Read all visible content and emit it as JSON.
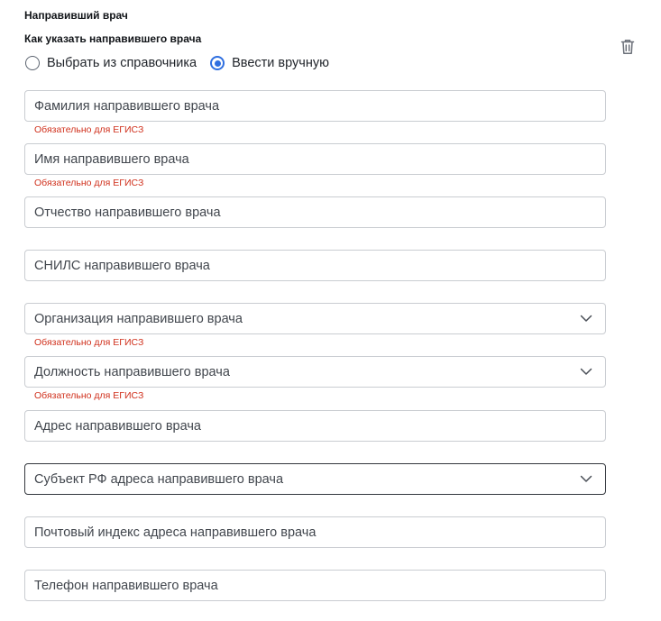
{
  "section": {
    "title": "Направивший врач",
    "mode_label": "Как указать направившего врача",
    "delete_icon": "trash-icon"
  },
  "mode": {
    "options": [
      {
        "label": "Выбрать из справочника",
        "selected": false
      },
      {
        "label": "Ввести вручную",
        "selected": true
      }
    ]
  },
  "fields": [
    {
      "placeholder": "Фамилия направившего врача",
      "type": "text",
      "hint": "Обязательно для ЕГИСЗ"
    },
    {
      "placeholder": "Имя направившего врача",
      "type": "text",
      "hint": "Обязательно для ЕГИСЗ"
    },
    {
      "placeholder": "Отчество направившего врача",
      "type": "text",
      "hint": ""
    },
    {
      "placeholder": "СНИЛС направившего врача",
      "type": "text",
      "hint": ""
    },
    {
      "placeholder": "Организация направившего врача",
      "type": "select",
      "hint": "Обязательно для ЕГИСЗ"
    },
    {
      "placeholder": "Должность направившего врача",
      "type": "select",
      "hint": "Обязательно для ЕГИСЗ"
    },
    {
      "placeholder": "Адрес направившего врача",
      "type": "text",
      "hint": ""
    },
    {
      "placeholder": "Субъект РФ адреса направившего врача",
      "type": "select",
      "hint": "",
      "focused": true
    },
    {
      "placeholder": "Почтовый индекс адреса направившего врача",
      "type": "text",
      "hint": ""
    },
    {
      "placeholder": "Телефон направившего врача",
      "type": "text",
      "hint": ""
    }
  ],
  "colors": {
    "accent": "#2f6fe0",
    "error": "#d0301c",
    "border": "#c9ccd1",
    "border_focused": "#33373d"
  }
}
